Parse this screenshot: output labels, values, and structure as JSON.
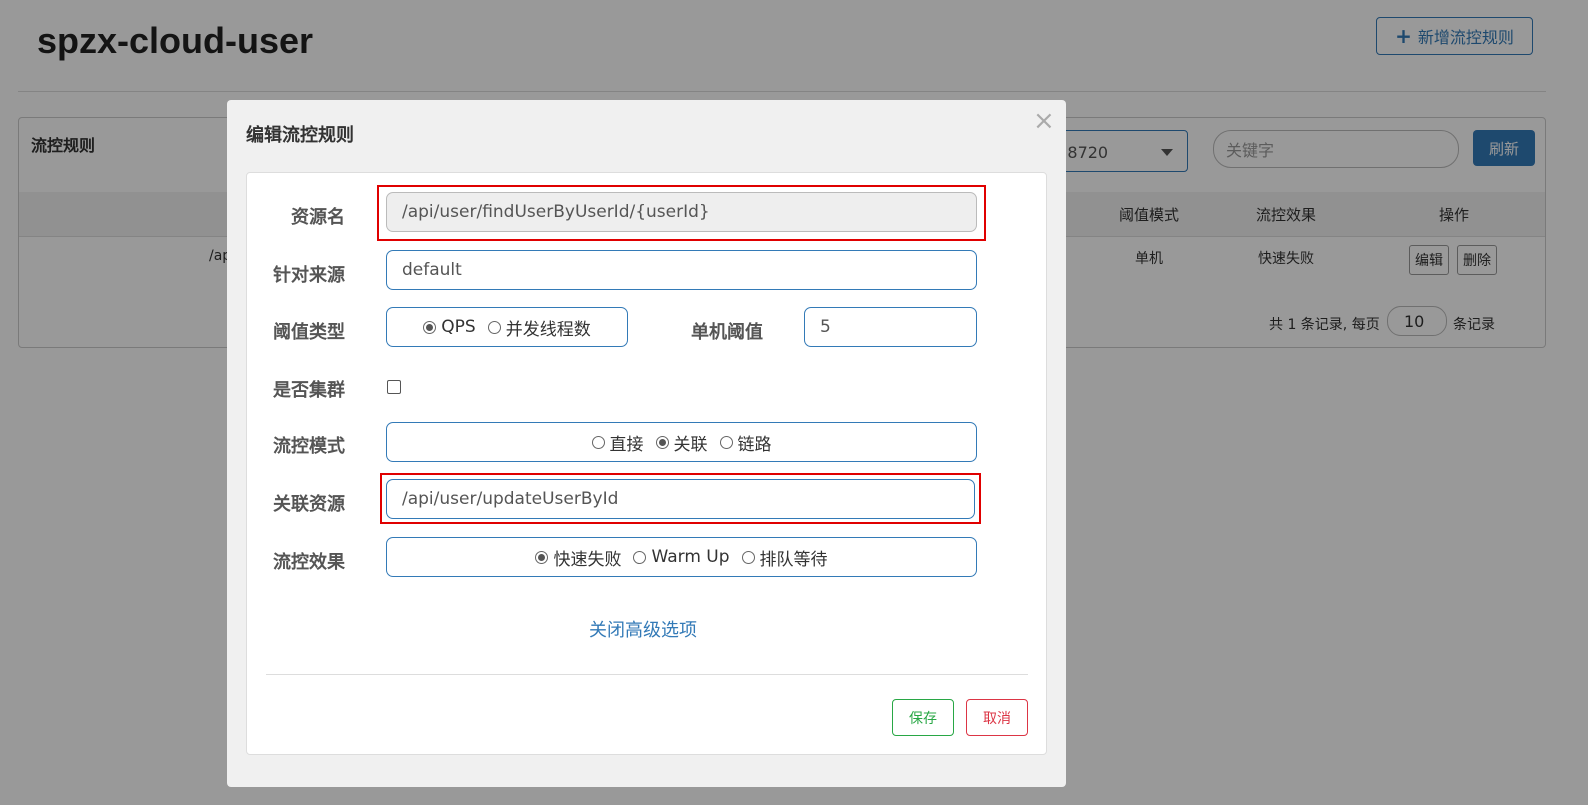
{
  "page": {
    "title": "spzx-cloud-user",
    "add_rule_button": "新增流控规则"
  },
  "panel": {
    "title": "流控规则",
    "machine_select_value": ":8720",
    "keyword_placeholder": "关键字",
    "refresh_button": "刷新",
    "table": {
      "headers": [
        "阈值模式",
        "流控效果",
        "操作"
      ],
      "row": {
        "resource_truncated": "/ap",
        "threshold_mode": "单机",
        "control_effect": "快速失败",
        "edit_button": "编辑",
        "delete_button": "删除"
      }
    },
    "pager": {
      "summary": "共 1 条记录, 每页",
      "page_size": "10",
      "suffix": "条记录"
    }
  },
  "modal": {
    "title": "编辑流控规则",
    "close_symbol": "×",
    "resource_label": "资源名",
    "resource_value": "/api/user/findUserByUserId/{userId}",
    "source_label": "针对来源",
    "source_value": "default",
    "threshold_type_label": "阈值类型",
    "threshold_type_options": [
      "QPS",
      "并发线程数"
    ],
    "threshold_type_selected": "QPS",
    "single_threshold_label": "单机阈值",
    "single_threshold_value": "5",
    "cluster_label": "是否集群",
    "cluster_checked": false,
    "mode_label": "流控模式",
    "mode_options": [
      "直接",
      "关联",
      "链路"
    ],
    "mode_selected": "关联",
    "ref_resource_label": "关联资源",
    "ref_resource_value": "/api/user/updateUserById",
    "effect_label": "流控效果",
    "effect_options": [
      "快速失败",
      "Warm Up",
      "排队等待"
    ],
    "effect_selected": "快速失败",
    "advanced_link": "关闭高级选项",
    "save_button": "保存",
    "cancel_button": "取消"
  },
  "colors": {
    "primary": "#337ab7",
    "save": "#28a745",
    "cancel": "#dc3545",
    "highlight": "#e00000"
  }
}
